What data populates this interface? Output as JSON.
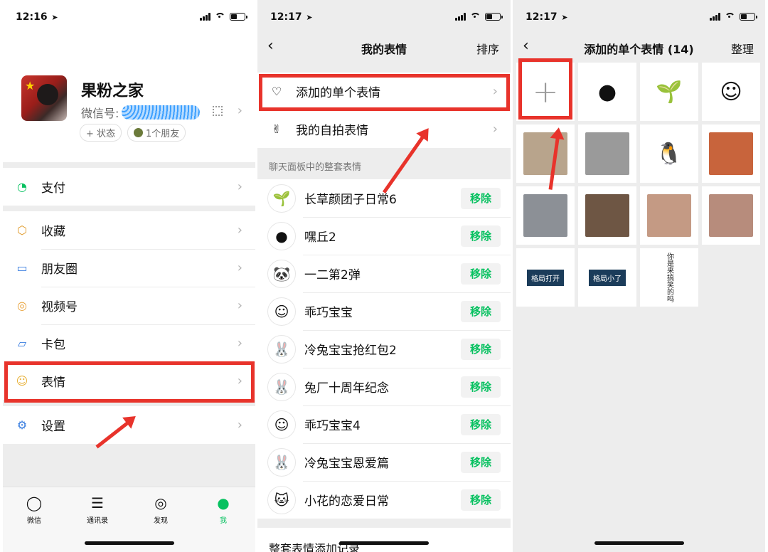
{
  "screen1": {
    "time": "12:16",
    "profile": {
      "nickname": "果粉之家",
      "wxid_label": "微信号:",
      "status_chip": "+ 状态",
      "friends_chip": "1个朋友"
    },
    "menu_pay": [
      {
        "label": "支付",
        "icon": "pay-icon"
      }
    ],
    "menu_main": [
      {
        "label": "收藏",
        "icon": "cube-icon"
      },
      {
        "label": "朋友圈",
        "icon": "image-icon"
      },
      {
        "label": "视频号",
        "icon": "play-icon"
      },
      {
        "label": "卡包",
        "icon": "card-icon"
      },
      {
        "label": "表情",
        "icon": "smile-icon"
      }
    ],
    "menu_settings": [
      {
        "label": "设置",
        "icon": "gear-icon"
      }
    ],
    "tabs": [
      {
        "label": "微信",
        "icon": "chat-icon"
      },
      {
        "label": "通讯录",
        "icon": "contacts-icon"
      },
      {
        "label": "发现",
        "icon": "compass-icon"
      },
      {
        "label": "我",
        "icon": "person-icon"
      }
    ]
  },
  "screen2": {
    "time": "12:17",
    "title": "我的表情",
    "right_action": "排序",
    "top_rows": [
      {
        "label": "添加的单个表情",
        "icon": "heart-icon"
      },
      {
        "label": "我的自拍表情",
        "icon": "peace-hand-icon"
      }
    ],
    "section_header": "聊天面板中的整套表情",
    "remove_label": "移除",
    "packs": [
      {
        "name": "长草颜团子日常6",
        "thumb": "🌱"
      },
      {
        "name": "嘿丘2",
        "thumb": "●"
      },
      {
        "name": "一二第2弹",
        "thumb": "🐼"
      },
      {
        "name": "乖巧宝宝",
        "thumb": "☺"
      },
      {
        "name": "冷兔宝宝抢红包2",
        "thumb": "🐰"
      },
      {
        "name": "兔厂十周年纪念",
        "thumb": "🐰"
      },
      {
        "name": "乖巧宝宝4",
        "thumb": "☺"
      },
      {
        "name": "冷兔宝宝恩爱篇",
        "thumb": "🐰"
      },
      {
        "name": "小花的恋爱日常",
        "thumb": "🐱"
      }
    ],
    "bottom_row": "整套表情添加记录"
  },
  "screen3": {
    "time": "12:17",
    "title": "添加的单个表情 (14)",
    "right_action": "整理",
    "cells": [
      {
        "kind": "plus",
        "text": "+"
      },
      {
        "kind": "emoji",
        "text": "●",
        "color": "#111111"
      },
      {
        "kind": "emoji",
        "text": "🌱",
        "color": "#ffffff"
      },
      {
        "kind": "emoji",
        "text": "☺",
        "color": "#ffffff"
      },
      {
        "kind": "photo",
        "color": "#b8a48c"
      },
      {
        "kind": "photo",
        "color": "#9a9a9a"
      },
      {
        "kind": "emoji",
        "text": "🐧",
        "color": "#ffffff"
      },
      {
        "kind": "photo",
        "color": "#c8643c"
      },
      {
        "kind": "photo",
        "color": "#8c9096"
      },
      {
        "kind": "photo",
        "color": "#6e5644"
      },
      {
        "kind": "photo",
        "color": "#c49a84"
      },
      {
        "kind": "photo",
        "color": "#b78c7c"
      },
      {
        "kind": "label",
        "text": "格局打开"
      },
      {
        "kind": "label",
        "text": "格局小了"
      },
      {
        "kind": "handwriting",
        "text": "你是来搞笑的吗"
      }
    ]
  },
  "colors": {
    "highlight": "#e8332b",
    "accent_green": "#07c160"
  }
}
